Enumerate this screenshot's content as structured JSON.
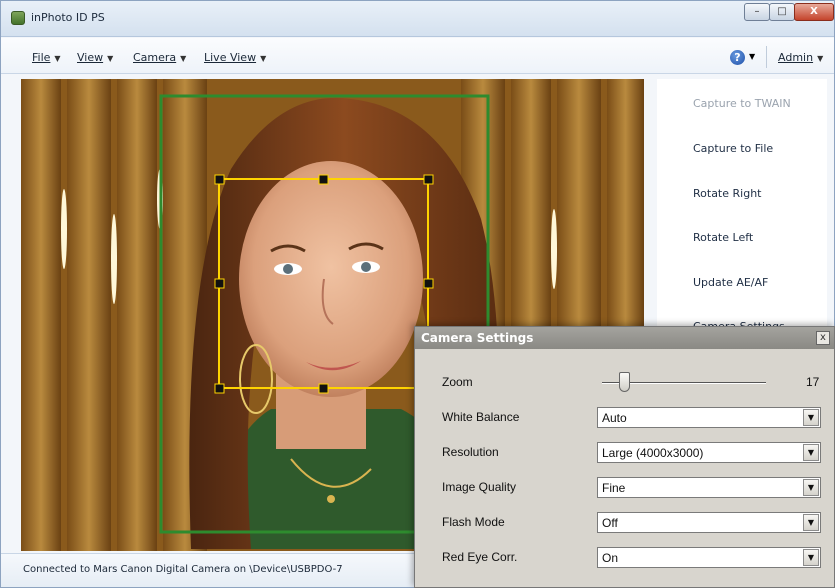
{
  "window": {
    "title": "inPhoto ID PS",
    "minimize": "–",
    "maximize": "□",
    "close": "X"
  },
  "menus": [
    {
      "label": "File"
    },
    {
      "label": "View"
    },
    {
      "label": "Camera"
    },
    {
      "label": "Live View"
    }
  ],
  "help_icon": "?",
  "admin_menu": "Admin",
  "actions": [
    {
      "label": "Capture to TWAIN",
      "enabled": false
    },
    {
      "label": "Capture to File",
      "enabled": true
    },
    {
      "label": "Rotate Right",
      "enabled": true
    },
    {
      "label": "Rotate Left",
      "enabled": true
    },
    {
      "label": "Update AE/AF",
      "enabled": true
    },
    {
      "label": "Camera Settings",
      "enabled": true
    }
  ],
  "status": "Connected to Mars Canon Digital Camera on \\Device\\USBPDO-7",
  "camera_settings": {
    "title": "Camera Settings",
    "close": "x",
    "zoom": {
      "label": "Zoom",
      "value": "17"
    },
    "white_balance": {
      "label": "White Balance",
      "value": "Auto"
    },
    "resolution": {
      "label": "Resolution",
      "value": "Large (4000x3000)"
    },
    "image_quality": {
      "label": "Image Quality",
      "value": "Fine"
    },
    "flash_mode": {
      "label": "Flash Mode",
      "value": "Off"
    },
    "red_eye": {
      "label": "Red Eye Corr.",
      "value": "On"
    }
  },
  "colors": {
    "crop_frame": "#2e8b2e",
    "face_frame": "#ffd400",
    "accent": "#1d4fa8"
  }
}
